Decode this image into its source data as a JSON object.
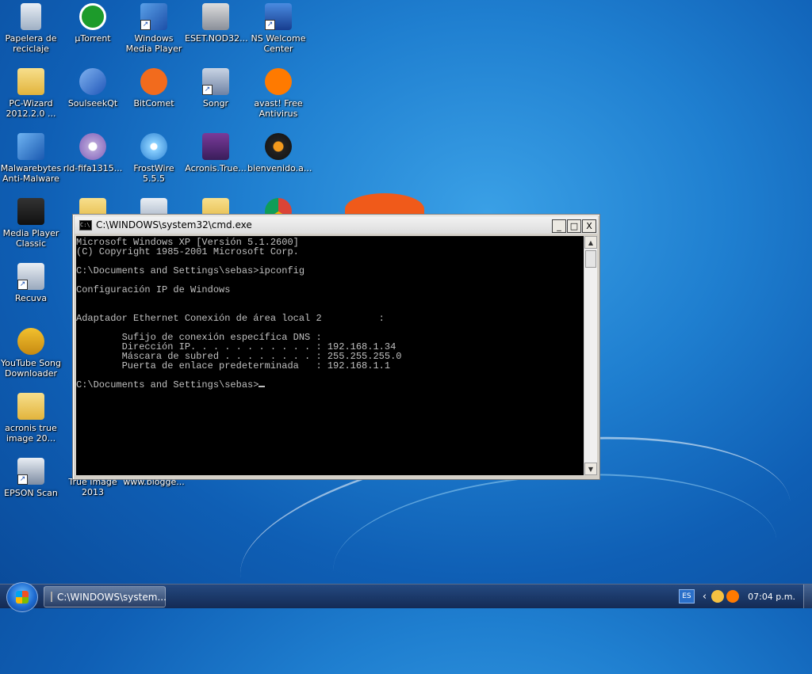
{
  "desktop": {
    "icons": [
      {
        "label": "Papelera de reciclaje",
        "icon": "recycle-bin-icon"
      },
      {
        "label": "µTorrent",
        "icon": "utorrent-icon"
      },
      {
        "label": "Windows Media Player",
        "icon": "windows-media-player-icon"
      },
      {
        "label": "ESET.NOD32...",
        "icon": "eset-icon"
      },
      {
        "label": "NS Welcome Center",
        "icon": "ns-welcome-icon"
      },
      {
        "label": "PC-Wizard 2012.2.0 ...",
        "icon": "folder-icon"
      },
      {
        "label": "SoulseekQt",
        "icon": "soulseek-icon"
      },
      {
        "label": "BitComet",
        "icon": "bitcomet-icon"
      },
      {
        "label": "Songr",
        "icon": "songr-icon"
      },
      {
        "label": "avast! Free Antivirus",
        "icon": "avast-icon"
      },
      {
        "label": "Malwarebytes Anti-Malware",
        "icon": "malwarebytes-icon"
      },
      {
        "label": "rld-fifa1315...",
        "icon": "dvd-icon"
      },
      {
        "label": "FrostWire 5.5.5",
        "icon": "frostwire-icon"
      },
      {
        "label": "Acronis.True...",
        "icon": "winrar-icon"
      },
      {
        "label": "bienvenido.a...",
        "icon": "bienvenido-icon"
      },
      {
        "label": "Media Player Classic",
        "icon": "media-player-classic-icon"
      },
      {
        "label": "Recuva",
        "icon": "recuva-icon"
      },
      {
        "label": "YouTube Song Downloader",
        "icon": "youtube-song-downloader-icon"
      },
      {
        "label": "acronis true image 20...",
        "icon": "folder-icon"
      },
      {
        "label": "EPSON Scan",
        "icon": "epson-scan-icon"
      },
      {
        "label": "True Image 2013",
        "icon": "true-image-icon"
      },
      {
        "label": "www.blogge...",
        "icon": "web-shortcut-icon"
      }
    ]
  },
  "cmd_window": {
    "title": "C:\\WINDOWS\\system32\\cmd.exe",
    "controls": {
      "minimize": "_",
      "maximize": "□",
      "close": "X"
    },
    "lines": [
      "Microsoft Windows XP [Versión 5.1.2600]",
      "(C) Copyright 1985-2001 Microsoft Corp.",
      "",
      "C:\\Documents and Settings\\sebas>ipconfig",
      "",
      "Configuración IP de Windows",
      "",
      "",
      "Adaptador Ethernet Conexión de área local 2          :",
      "",
      "        Sufijo de conexión específica DNS :",
      "        Dirección IP. . . . . . . . . . . : 192.168.1.34",
      "        Máscara de subred . . . . . . . . : 255.255.255.0",
      "        Puerta de enlace predeterminada   : 192.168.1.1",
      ""
    ],
    "prompt": "C:\\Documents and Settings\\sebas>"
  },
  "taskbar": {
    "task_button_label": "C:\\WINDOWS\\system...",
    "language": "ES",
    "clock": "07:04 p.m."
  }
}
